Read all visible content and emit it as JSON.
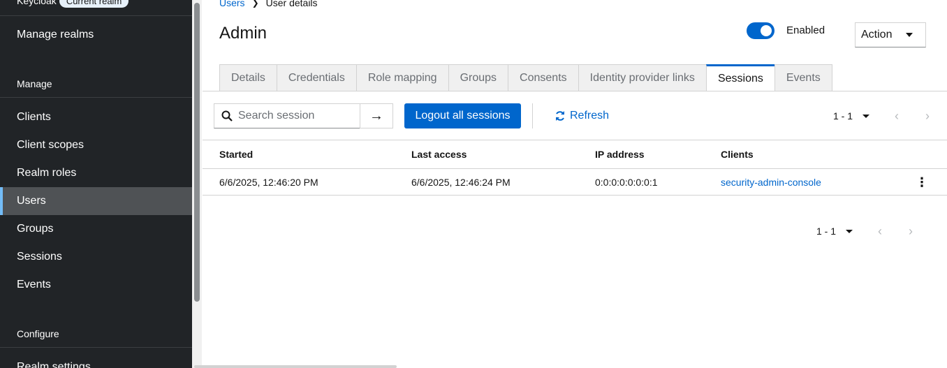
{
  "sidebar": {
    "realm_name": "Keycloak",
    "realm_badge": "Current realm",
    "manage_realms": "Manage realms",
    "manage_section": "Manage",
    "items": [
      {
        "label": "Clients"
      },
      {
        "label": "Client scopes"
      },
      {
        "label": "Realm roles"
      },
      {
        "label": "Users"
      },
      {
        "label": "Groups"
      },
      {
        "label": "Sessions"
      },
      {
        "label": "Events"
      }
    ],
    "configure_section": "Configure",
    "realm_settings": "Realm settings"
  },
  "breadcrumb": {
    "parent": "Users",
    "current": "User details"
  },
  "header": {
    "title": "Admin",
    "enabled_label": "Enabled",
    "enabled": true,
    "action_label": "Action"
  },
  "tabs": [
    {
      "label": "Details"
    },
    {
      "label": "Credentials"
    },
    {
      "label": "Role mapping"
    },
    {
      "label": "Groups"
    },
    {
      "label": "Consents"
    },
    {
      "label": "Identity provider links"
    },
    {
      "label": "Sessions"
    },
    {
      "label": "Events"
    }
  ],
  "active_tab": "Sessions",
  "toolbar": {
    "search_placeholder": "Search session",
    "logout_all_label": "Logout all sessions",
    "refresh_label": "Refresh"
  },
  "pagination": {
    "range": "1 - 1"
  },
  "table": {
    "columns": [
      "Started",
      "Last access",
      "IP address",
      "Clients"
    ],
    "rows": [
      {
        "started": "6/6/2025, 12:46:20 PM",
        "last_access": "6/6/2025, 12:46:24 PM",
        "ip_address": "0:0:0:0:0:0:0:1",
        "clients": "security-admin-console"
      }
    ]
  },
  "colors": {
    "accent": "#0066cc",
    "sidebar_bg": "#212427",
    "sidebar_active": "#4f5255",
    "active_indicator": "#73bcf7"
  }
}
